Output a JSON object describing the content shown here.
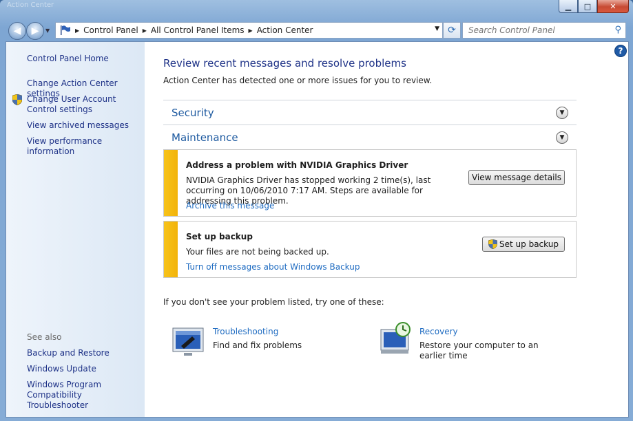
{
  "window": {
    "ghost_title": "Action Center",
    "caption": {
      "min": "▁",
      "max": "□",
      "close": "✕"
    }
  },
  "nav": {
    "back_icon": "back-arrow-icon",
    "forward_icon": "forward-arrow-icon",
    "breadcrumbs": [
      "Control Panel",
      "All Control Panel Items",
      "Action Center"
    ],
    "search_placeholder": "Search Control Panel"
  },
  "sidebar": {
    "home": "Control Panel Home",
    "links": [
      "Change Action Center settings",
      "Change User Account Control settings",
      "View archived messages",
      "View performance information"
    ],
    "see_also_label": "See also",
    "see_also": [
      "Backup and Restore",
      "Windows Update",
      "Windows Program Compatibility Troubleshooter"
    ]
  },
  "main": {
    "heading": "Review recent messages and resolve problems",
    "subheading": "Action Center has detected one or more issues for you to review.",
    "sections": [
      {
        "label": "Security"
      },
      {
        "label": "Maintenance"
      }
    ],
    "cards": [
      {
        "title": "Address a problem with NVIDIA Graphics Driver",
        "body": "NVIDIA Graphics Driver has stopped working  2 time(s), last occurring on 10/06/2010 7:17 AM.  Steps are available for addressing this problem.",
        "link": "Archive this message",
        "button": "View message details",
        "status_color": "#f5bd14"
      },
      {
        "title": "Set up backup",
        "body": "Your files are not being backed up.",
        "link": "Turn off messages about Windows Backup",
        "button": "Set up backup",
        "status_color": "#f5bd14"
      }
    ],
    "try_text": "If you don't see your problem listed, try one of these:",
    "tools": [
      {
        "link": "Troubleshooting",
        "desc": "Find and fix problems",
        "icon": "troubleshooting-icon"
      },
      {
        "link": "Recovery",
        "desc": "Restore your computer to an earlier time",
        "icon": "recovery-icon"
      }
    ]
  },
  "colors": {
    "link": "#1e6bc1",
    "heading": "#1e3287",
    "warning": "#f5bd14"
  }
}
